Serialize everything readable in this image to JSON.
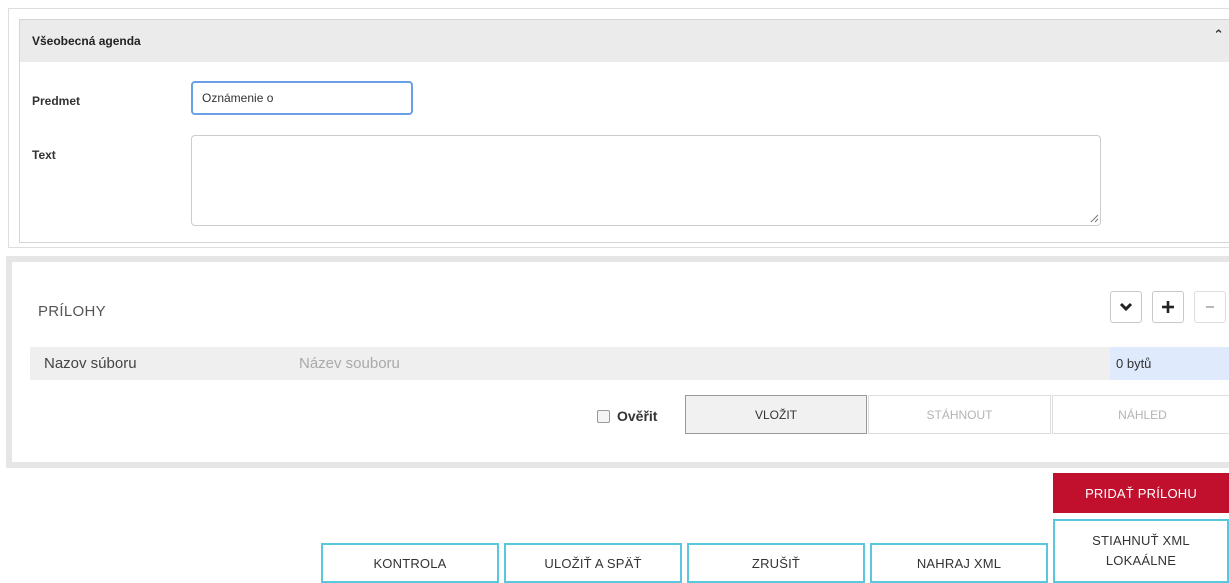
{
  "agenda": {
    "title": "Všeobecná agenda",
    "collapse_icon": "caret-up-icon",
    "subject_label": "Predmet",
    "subject_value": "Oznámenie o",
    "text_label": "Text",
    "text_value": ""
  },
  "attachments": {
    "title": "PRÍLOHY",
    "toolbar": {
      "expand_icon": "chevron-down-icon",
      "add_icon": "plus-icon",
      "remove_icon": "minus-icon"
    },
    "file_row": {
      "label": "Nazov súboru",
      "placeholder": "Název souboru",
      "size": "0 bytů"
    },
    "verify_label": "Ověřit",
    "insert_label": "VLOŽIT",
    "download_label": "STÁHNOUT",
    "preview_label": "NÁHLED"
  },
  "actions": {
    "add_attachment": "PRIDAŤ PRÍLOHU",
    "check": "KONTROLA",
    "save_back": "ULOŽIŤ A SPÄŤ",
    "cancel": "ZRUŠIŤ",
    "upload_xml": "NAHRAJ XML",
    "download_xml_line1": "STIAHNUŤ XML",
    "download_xml_line2": "LOKAÁLNE"
  },
  "colors": {
    "accent_red": "#c0102d",
    "accent_cyan": "#59c7dd",
    "input_focus": "#6aa0e6"
  }
}
